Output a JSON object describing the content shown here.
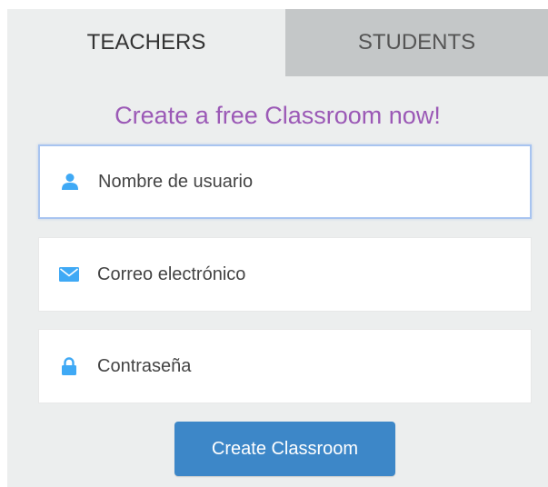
{
  "tabs": [
    {
      "label": "TEACHERS",
      "active": true
    },
    {
      "label": "STUDENTS",
      "active": false
    }
  ],
  "heading": "Create a free Classroom now!",
  "form": {
    "username": {
      "placeholder": "Nombre de usuario",
      "value": "",
      "icon": "user-icon"
    },
    "email": {
      "placeholder": "Correo electrónico",
      "value": "",
      "icon": "envelope-icon"
    },
    "password": {
      "placeholder": "Contraseña",
      "value": "",
      "icon": "lock-icon"
    }
  },
  "submit_label": "Create Classroom",
  "colors": {
    "accent": "#3d87c8",
    "icon": "#3fa9f5",
    "heading": "#9b59b6",
    "panel_bg": "#eceeee",
    "inactive_tab_bg": "#c4c7c8"
  }
}
